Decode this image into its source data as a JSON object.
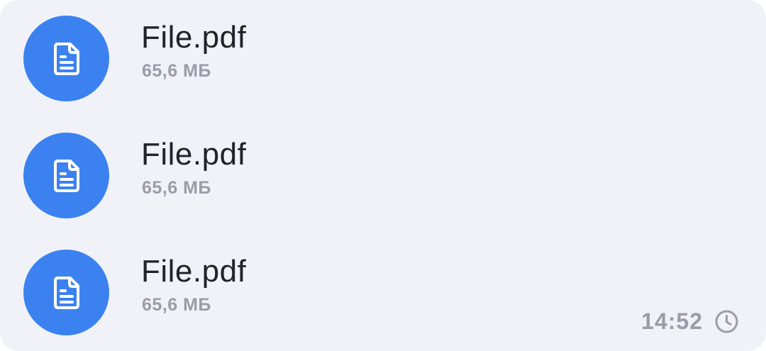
{
  "message": {
    "files": [
      {
        "name": "File.pdf",
        "size": "65,6 МБ",
        "icon": "document-icon"
      },
      {
        "name": "File.pdf",
        "size": "65,6 МБ",
        "icon": "document-icon"
      },
      {
        "name": "File.pdf",
        "size": "65,6 МБ",
        "icon": "document-icon"
      }
    ],
    "time": "14:52",
    "status_icon": "clock-icon"
  },
  "colors": {
    "bubble_background": "#f1f2f7",
    "file_icon_background": "#3b82f0",
    "file_name_text": "#22232a",
    "secondary_text": "#9a9ca8"
  }
}
